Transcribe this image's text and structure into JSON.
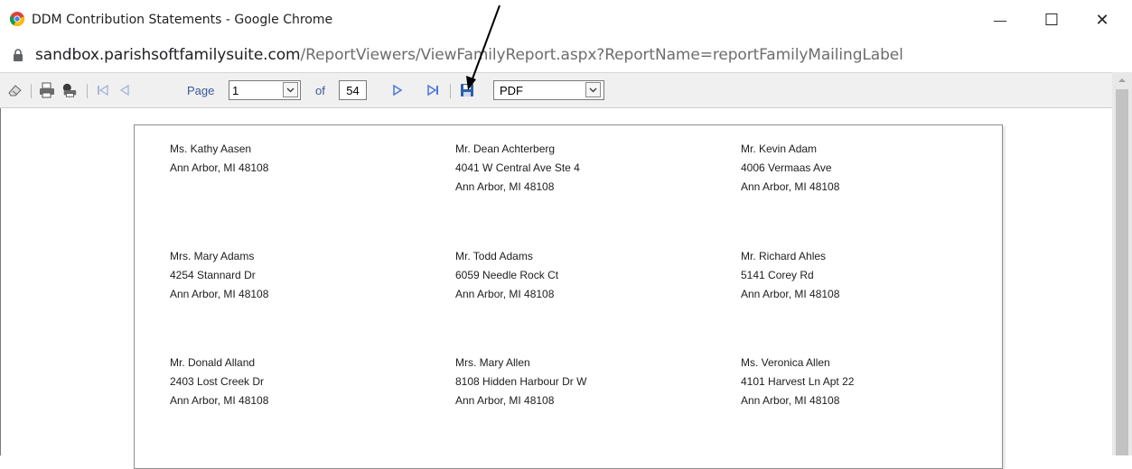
{
  "window": {
    "title": "DDM Contribution Statements - Google Chrome",
    "minimize": "—",
    "maximize": "☐",
    "close": "✕"
  },
  "address": {
    "host": "sandbox.parishsoftfamilysuite.com",
    "path": "/ReportViewers/ViewFamilyReport.aspx?ReportName=reportFamilyMailingLabel"
  },
  "toolbar": {
    "page_label": "Page",
    "current_page": "1",
    "of_label": "of",
    "total_pages": "54",
    "export_format": "PDF",
    "icons": [
      "eraser-icon",
      "print-icon",
      "print-setup-icon",
      "first-page-icon",
      "previous-page-icon",
      "next-page-icon",
      "last-page-icon",
      "save-icon"
    ]
  },
  "labels": [
    {
      "name": "Ms. Kathy Aasen",
      "line1": "Ann Arbor, MI  48108",
      "line2": ""
    },
    {
      "name": "Mr. Dean Achterberg",
      "line1": "4041 W Central Ave Ste 4",
      "line2": "Ann Arbor, MI  48108"
    },
    {
      "name": "Mr. Kevin Adam",
      "line1": "4006 Vermaas Ave",
      "line2": "Ann Arbor, MI  48108"
    },
    {
      "name": "Mrs. Mary Adams",
      "line1": "4254 Stannard Dr",
      "line2": "Ann Arbor, MI  48108"
    },
    {
      "name": "Mr. Todd Adams",
      "line1": "6059 Needle Rock Ct",
      "line2": "Ann Arbor, MI  48108"
    },
    {
      "name": "Mr. Richard Ahles",
      "line1": "5141 Corey Rd",
      "line2": "Ann Arbor, MI  48108"
    },
    {
      "name": "Mr. Donald Alland",
      "line1": "2403 Lost Creek Dr",
      "line2": "Ann Arbor, MI  48108"
    },
    {
      "name": "Mrs. Mary Allen",
      "line1": "8108 Hidden Harbour Dr W",
      "line2": "Ann Arbor, MI  48108"
    },
    {
      "name": "Ms. Veronica Allen",
      "line1": "4101 Harvest  Ln Apt 22",
      "line2": "Ann Arbor, MI  48108"
    }
  ],
  "colors": {
    "toolbar_bg": "#f0f0f0",
    "toolbar_text": "#3b5998",
    "nav_arrow": "#4a78d6",
    "nav_disabled": "#a9b8d8"
  }
}
